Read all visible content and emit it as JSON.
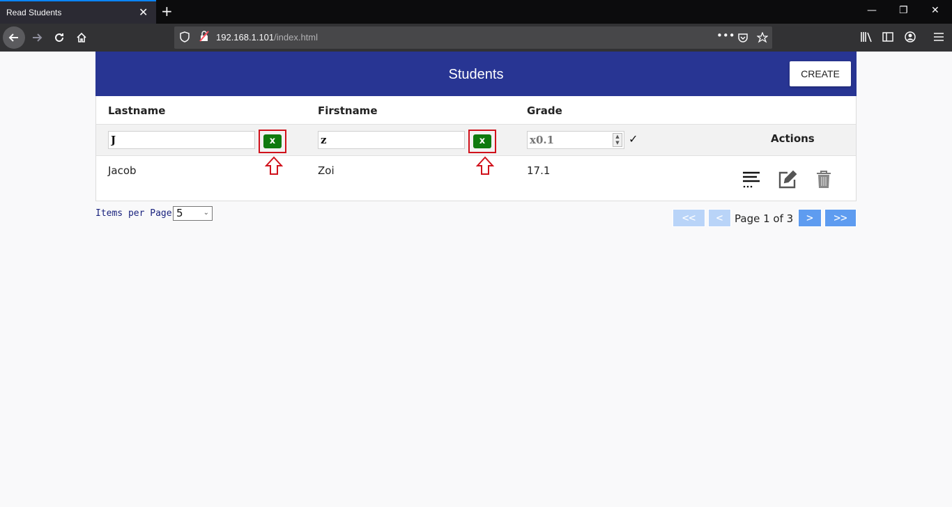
{
  "browser": {
    "tab_title": "Read Students",
    "tab_close": "✕",
    "new_tab": "+",
    "url_host": "192.168.1.101",
    "url_path": "/index.html",
    "window_controls": {
      "minimize": "—",
      "restore": "❐",
      "close": "✕"
    }
  },
  "header": {
    "title": "Students",
    "create_label": "CREATE"
  },
  "table": {
    "columns": {
      "lastname": "Lastname",
      "firstname": "Firstname",
      "grade": "Grade",
      "actions": "Actions"
    },
    "filters": {
      "lastname_value": "J",
      "firstname_value": "z",
      "grade_placeholder": "x0.1",
      "clear_label": "x",
      "apply_label": "✓"
    },
    "rows": [
      {
        "lastname": "Jacob",
        "firstname": "Zoi",
        "grade": "17.1"
      }
    ]
  },
  "footer": {
    "items_per_page_label": "Items per Page:",
    "items_per_page_value": "5",
    "first_label": "<<",
    "prev_label": "<",
    "page_text": "Page 1 of 3",
    "next_label": ">",
    "last_label": ">>"
  },
  "colors": {
    "header": "#283593",
    "clear_button": "#0f7a0f",
    "highlight_box": "#d0111b",
    "pager_active": "#5e9cf0",
    "pager_disabled": "#b9d4f8"
  }
}
